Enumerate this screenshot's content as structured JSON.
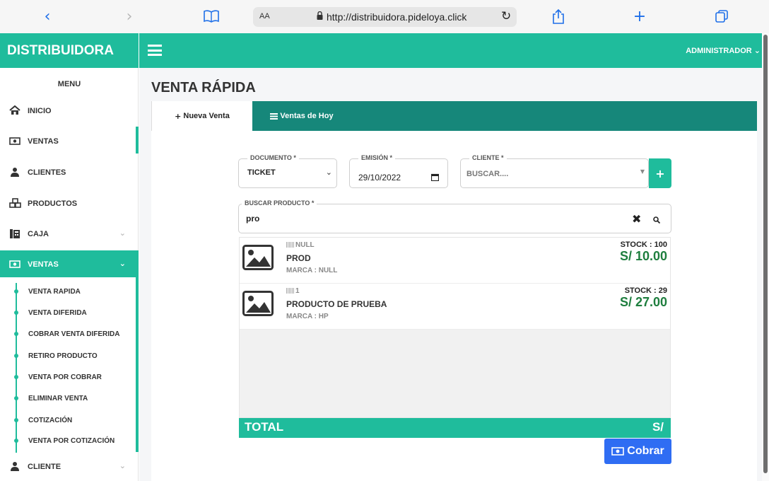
{
  "browser": {
    "aa": "AA",
    "url": "http://distribuidora.pideloya.click"
  },
  "header": {
    "brand": "DISTRIBUIDORA",
    "user": "ADMINISTRADOR"
  },
  "sidebar": {
    "menu_title": "MENU",
    "items": [
      {
        "label": "INICIO",
        "icon": "home-icon"
      },
      {
        "label": "VENTAS",
        "icon": "money-icon"
      },
      {
        "label": "CLIENTES",
        "icon": "user-icon"
      },
      {
        "label": "PRODUCTOS",
        "icon": "cubes-icon"
      },
      {
        "label": "CAJA",
        "icon": "calculator-icon"
      },
      {
        "label": "VENTAS",
        "icon": "money-icon"
      },
      {
        "label": "CLIENTE",
        "icon": "user-icon"
      }
    ],
    "submenu": [
      "VENTA RAPIDA",
      "VENTA DIFERIDA",
      "COBRAR VENTA DIFERIDA",
      "RETIRO PRODUCTO",
      "VENTA POR COBRAR",
      "ELIMINAR VENTA",
      "COTIZACIÓN",
      "VENTA POR COTIZACIÓN"
    ]
  },
  "page": {
    "title": "VENTA RÁPIDA",
    "tabs": [
      "Nueva Venta",
      "Ventas de Hoy"
    ]
  },
  "form": {
    "documento": {
      "label": "DOCUMENTO *",
      "value": "TICKET"
    },
    "emision": {
      "label": "EMISIÓN *",
      "value": "29/10/2022"
    },
    "cliente": {
      "label": "CLIENTE *",
      "placeholder": "BUSCAR...."
    },
    "buscar_producto": {
      "label": "BUSCAR PRODUCTO *",
      "value": "pro"
    }
  },
  "products": [
    {
      "code": "NULL",
      "name": "PROD",
      "brand": "MARCA : NULL",
      "stock": "STOCK : 100",
      "price": "S/ 10.00"
    },
    {
      "code": "1",
      "name": "PRODUCTO DE PRUEBA",
      "brand": "MARCA : HP",
      "stock": "STOCK : 29",
      "price": "S/ 27.00"
    }
  ],
  "total": {
    "label": "TOTAL",
    "value": "S/"
  },
  "cobrar_label": "Cobrar",
  "colors": {
    "accent": "#1fbc9c",
    "tab_bar": "#16877a",
    "price": "#1e7e3e",
    "button": "#2f6df3"
  }
}
